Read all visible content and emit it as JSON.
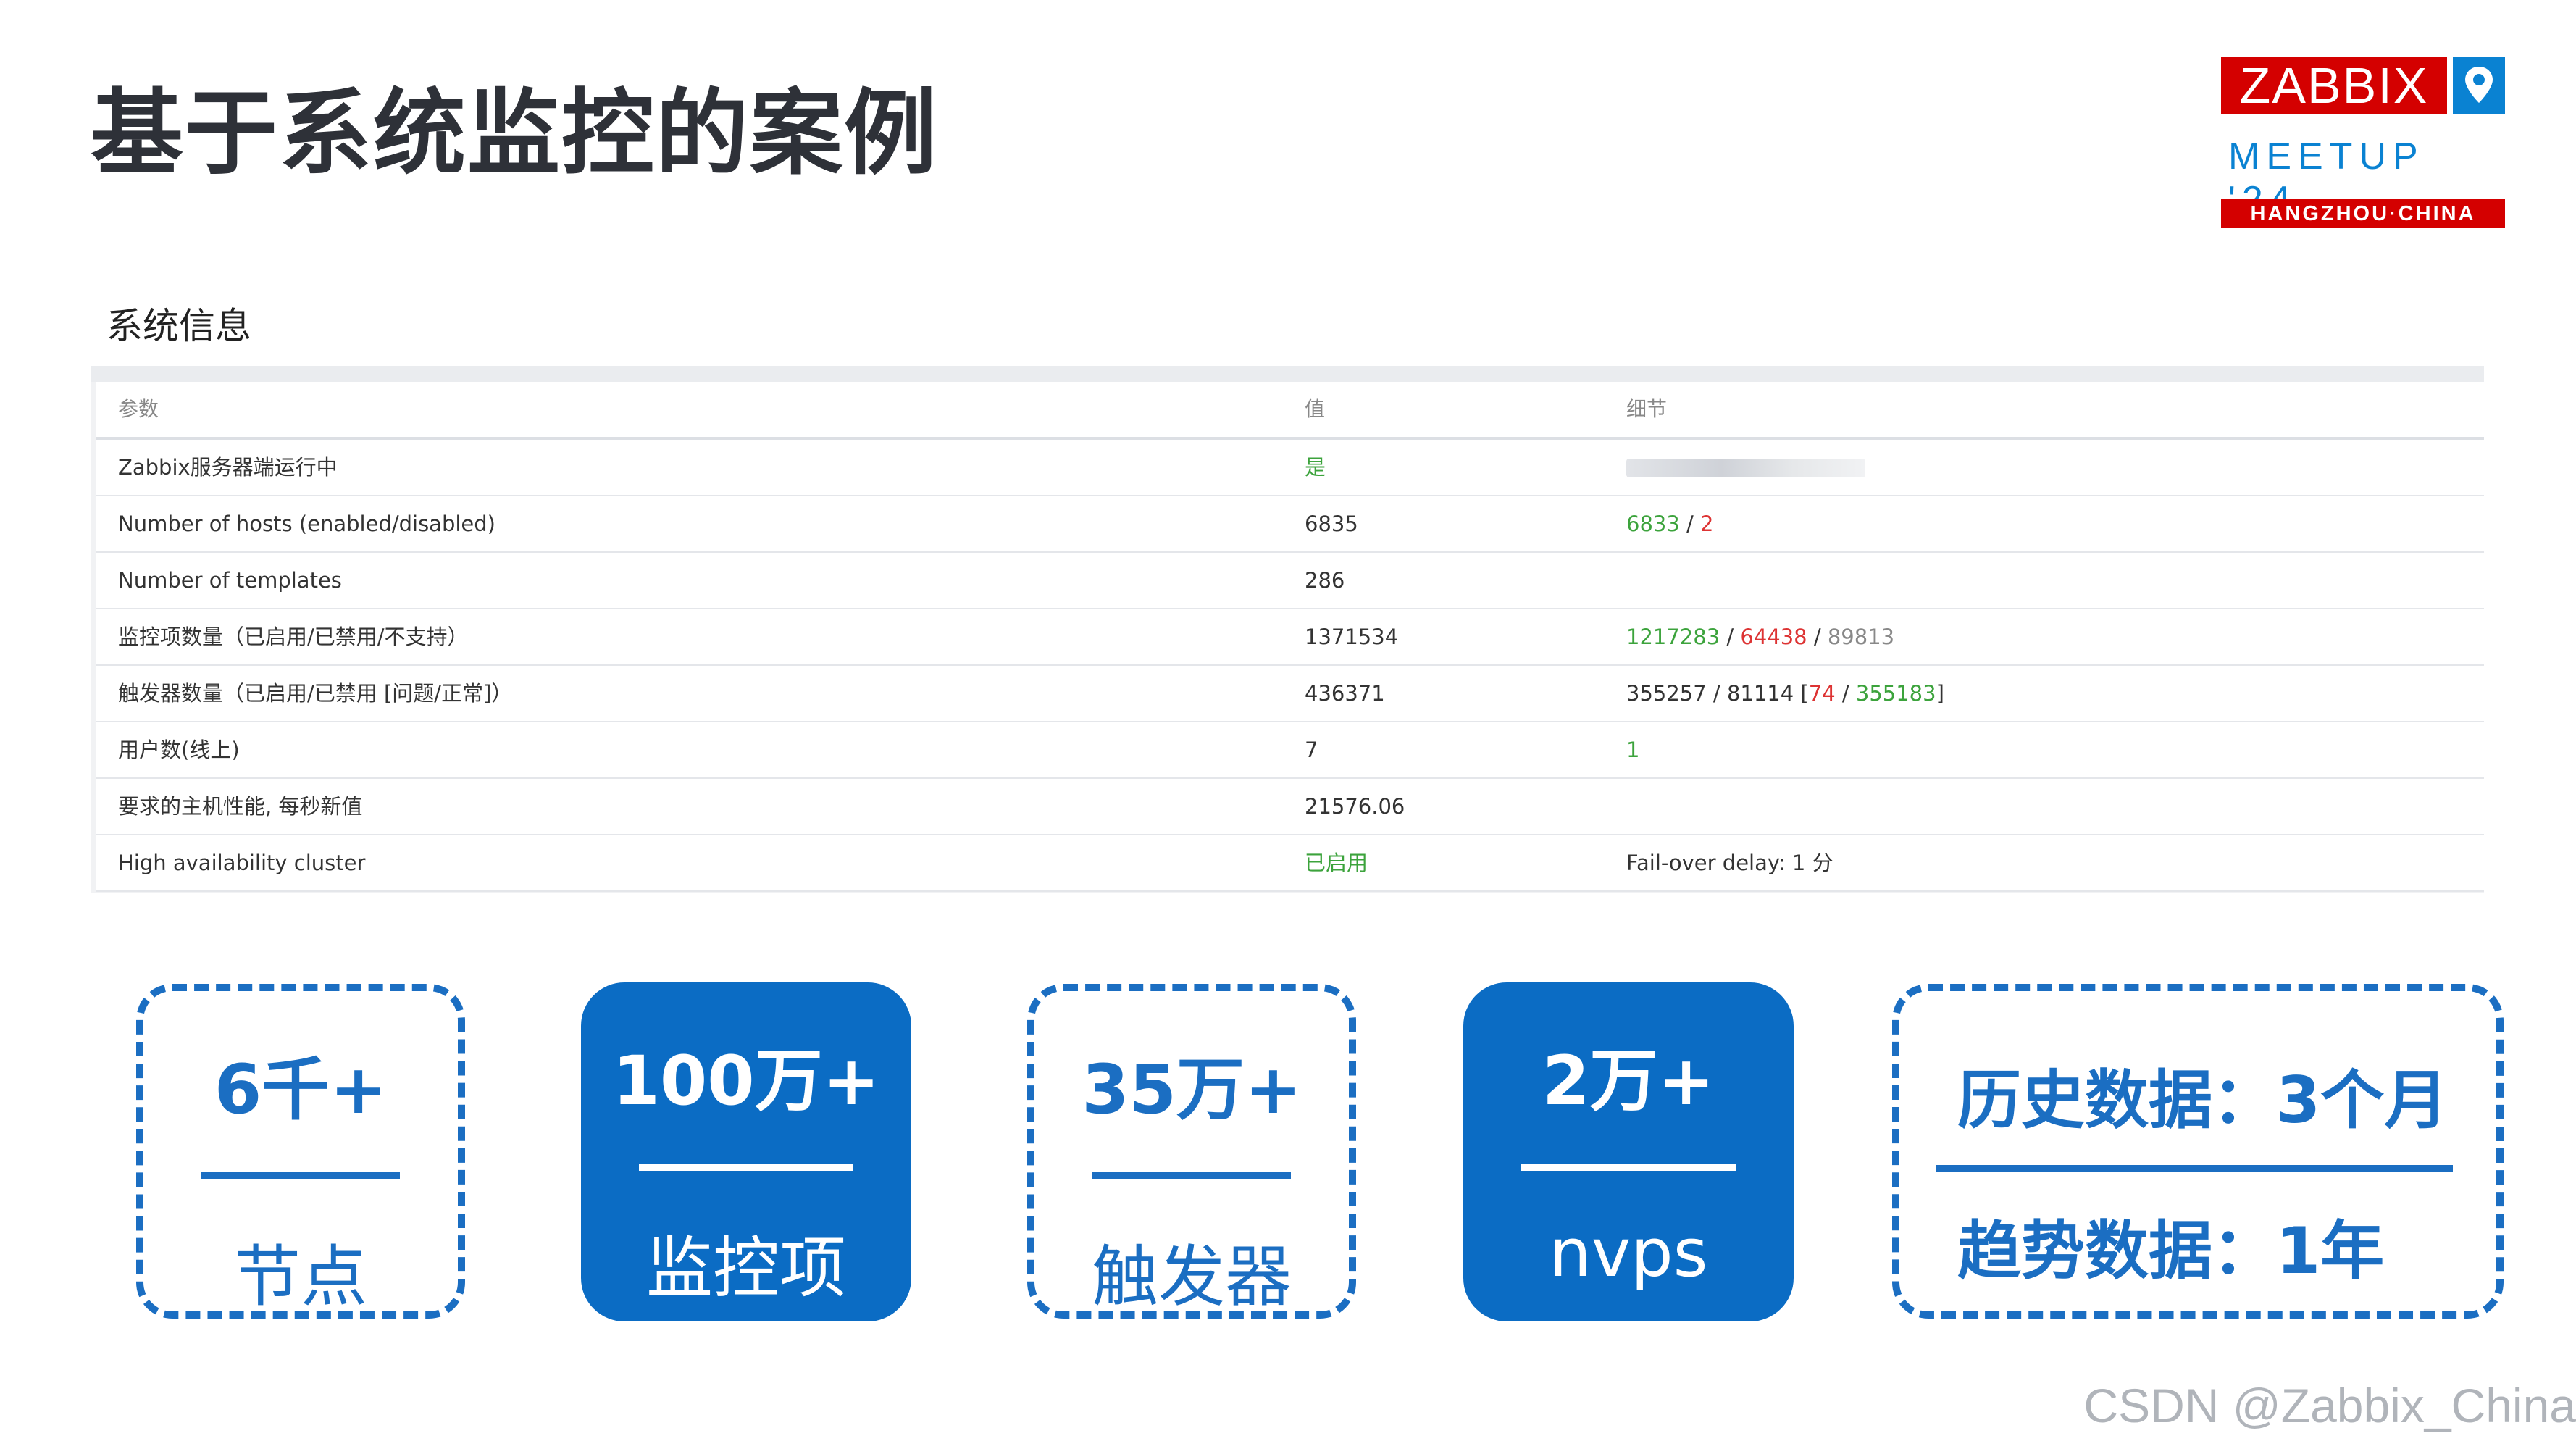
{
  "title": "基于系统监控的案例",
  "logo": {
    "brand": "ZABBIX",
    "event": "MEETUP '24",
    "city": "HANGZHOU·CHINA"
  },
  "system_info": {
    "title": "系统信息",
    "headers": [
      "参数",
      "值",
      "细节"
    ],
    "rows": [
      {
        "param": "Zabbix服务器端运行中",
        "value": "是"
      },
      {
        "param": "Number of hosts (enabled/disabled)",
        "value": "6835",
        "d1": "6833",
        "d2": "2"
      },
      {
        "param": "Number of templates",
        "value": "286"
      },
      {
        "param": "监控项数量（已启用/已禁用/不支持）",
        "value": "1371534",
        "d1": "1217283",
        "d2": "64438",
        "d3": "89813"
      },
      {
        "param": "触发器数量（已启用/已禁用 [问题/正常]）",
        "value": "436371",
        "d1": "355257",
        "d2": "81114",
        "d3": "74",
        "d4": "355183"
      },
      {
        "param": "用户数(线上)",
        "value": "7",
        "d1": "1"
      },
      {
        "param": "要求的主机性能, 每秒新值",
        "value": "21576.06"
      },
      {
        "param": "High availability cluster",
        "value": "已启用",
        "d1": "Fail-over delay: 1 分"
      }
    ]
  },
  "cards": [
    {
      "big": "6千+",
      "small": "节点"
    },
    {
      "big": "100万+",
      "small": "监控项"
    },
    {
      "big": "35万+",
      "small": "触发器"
    },
    {
      "big": "2万+",
      "small": "nvps"
    }
  ],
  "history": {
    "line1": "历史数据：3个月",
    "line2": "趋势数据：1年"
  },
  "watermark": "CSDN @Zabbix_China",
  "colors": {
    "blue": "#0b6cc4",
    "zabbix_red": "#d40000",
    "green": "#3ca33c",
    "red": "#dd3333"
  }
}
